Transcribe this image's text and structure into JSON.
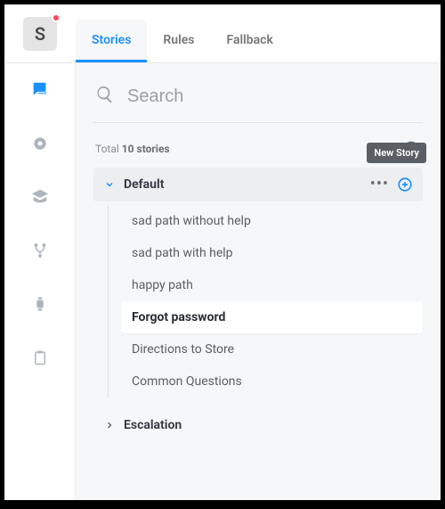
{
  "logo": {
    "letter": "S"
  },
  "tabs": [
    {
      "label": "Stories",
      "active": true
    },
    {
      "label": "Rules",
      "active": false
    },
    {
      "label": "Fallback",
      "active": false
    }
  ],
  "search": {
    "placeholder": "Search"
  },
  "total": {
    "prefix": "Total",
    "count": "10 stories"
  },
  "tooltip": {
    "new_story": "New Story"
  },
  "groups": [
    {
      "name": "Default",
      "expanded": true,
      "items": [
        {
          "label": "sad path without help",
          "selected": false
        },
        {
          "label": "sad path with help",
          "selected": false
        },
        {
          "label": "happy path",
          "selected": false
        },
        {
          "label": "Forgot password",
          "selected": true
        },
        {
          "label": "Directions to Store",
          "selected": false
        },
        {
          "label": "Common Questions",
          "selected": false
        }
      ]
    },
    {
      "name": "Escalation",
      "expanded": false,
      "items": []
    }
  ]
}
